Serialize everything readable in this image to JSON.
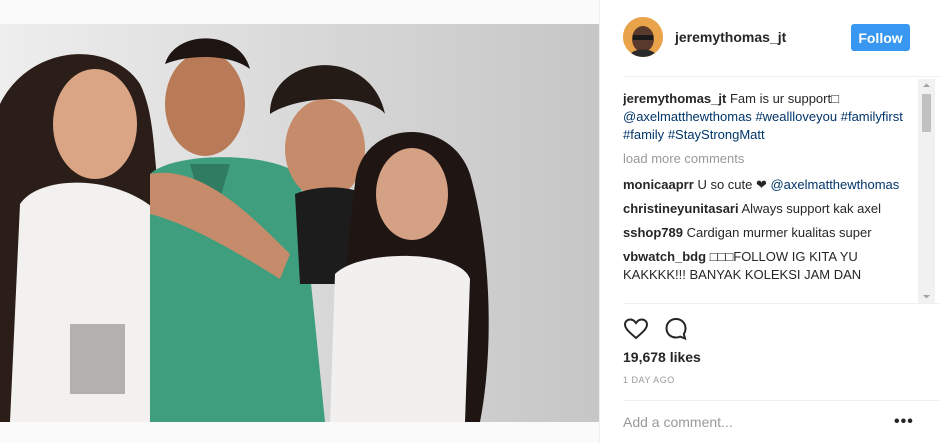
{
  "post": {
    "username": "jeremythomas_jt",
    "follow_label": "Follow",
    "caption": {
      "user": "jeremythomas_jt",
      "text": "Fam is ur support□",
      "tags": [
        "@axelmatthewthomas",
        "#weallloveyou",
        "#familyfirst",
        "#family",
        "#StayStrongMatt"
      ]
    },
    "load_more": "load more comments",
    "comments": [
      {
        "user": "monicaaprr",
        "text": "U so cute ❤",
        "tag": "@axelmatthewthomas"
      },
      {
        "user": "christineyunitasari",
        "text": "Always support kak axel"
      },
      {
        "user": "sshop789",
        "text": "Cardigan murmer kualitas super"
      },
      {
        "user": "vbwatch_bdg",
        "text": "□□□FOLLOW IG KITA YU KAKKKK!!! BANYAK KOLEKSI JAM DAN"
      }
    ],
    "likes": "19,678 likes",
    "time": "1 DAY AGO",
    "add_comment_placeholder": "Add a comment...",
    "more_options": "•••"
  },
  "icons": {
    "like": "heart-icon",
    "comment": "comment-bubble-icon",
    "options": "more-options-icon"
  },
  "colors": {
    "accent": "#3897f0",
    "hashtag": "#003569",
    "muted": "#999999"
  }
}
